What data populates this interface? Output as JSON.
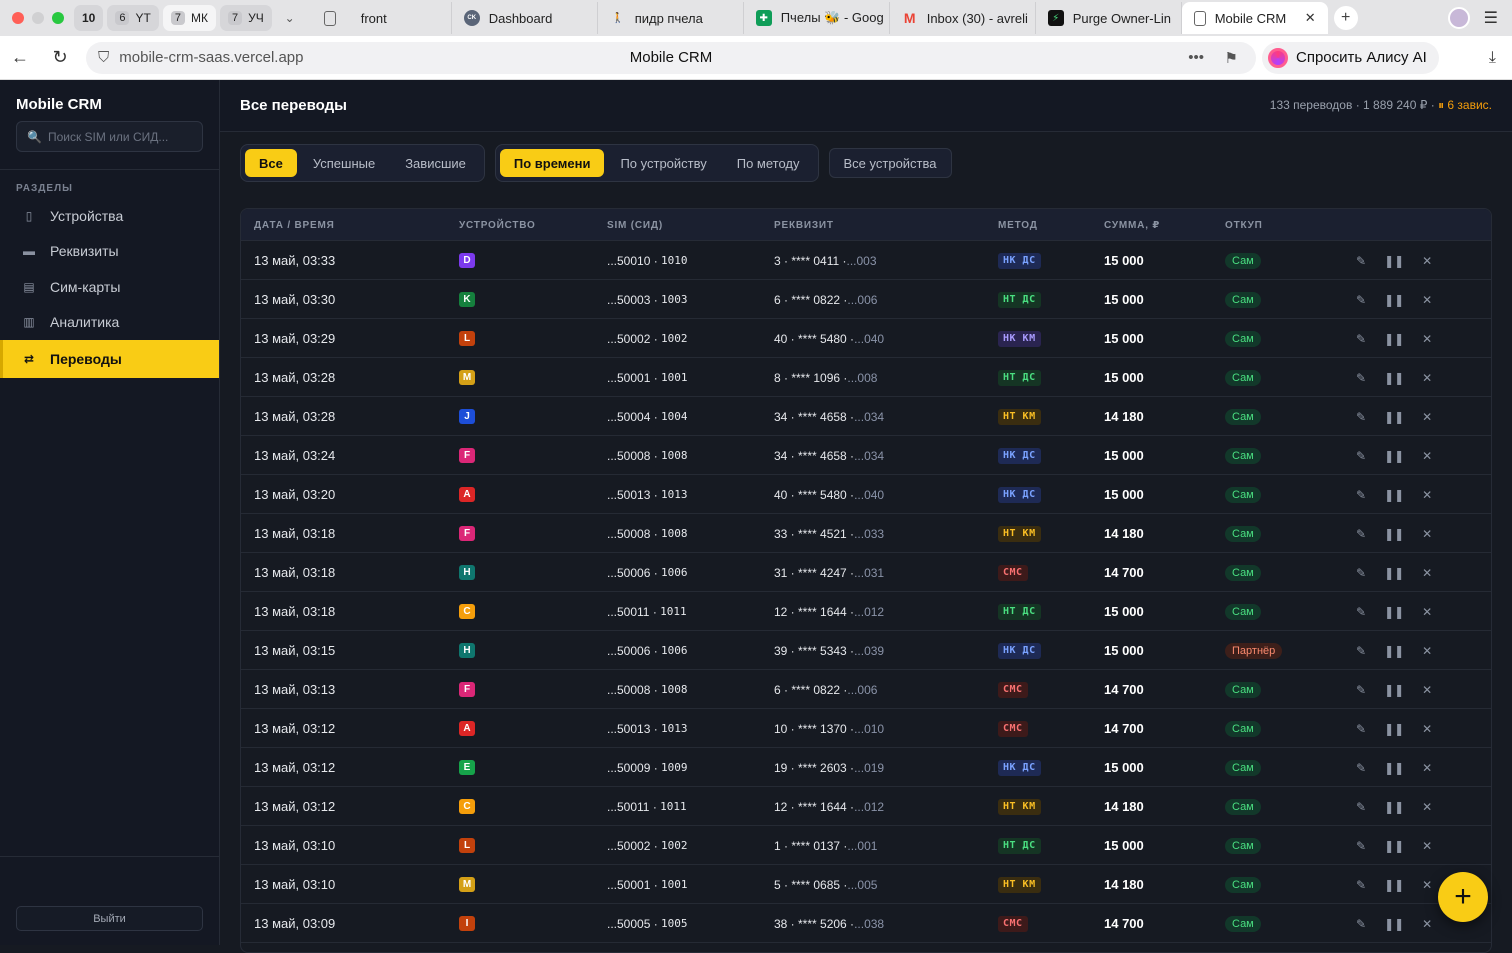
{
  "browser": {
    "pinned": [
      {
        "count": "10",
        "label": ""
      },
      {
        "count": "6",
        "label": "YT"
      },
      {
        "count": "7",
        "label": "МК"
      },
      {
        "count": "7",
        "label": "УЧ"
      }
    ],
    "tabs": [
      {
        "title": "front",
        "icon": "file-icon",
        "color": "#ffffff"
      },
      {
        "title": "Dashboard",
        "icon": "ck-icon",
        "color": "#5a6578"
      },
      {
        "title": "пидр пчела",
        "icon": "figure-icon",
        "color": "#ffffff"
      },
      {
        "title": "Пчелы 🐝 - Goog",
        "icon": "sheets-icon",
        "color": "#0f9d58"
      },
      {
        "title": "Inbox (30) - avreli",
        "icon": "gmail-icon",
        "color": "#ffffff"
      },
      {
        "title": "Purge Owner-Lin",
        "icon": "bolt-icon",
        "color": "#111111"
      },
      {
        "title": "Mobile CRM",
        "icon": "file-icon",
        "color": "#ffffff"
      }
    ],
    "url": "mobile-crm-saas.vercel.app",
    "page_title": "Mobile CRM",
    "alice": "Спросить Алису AI"
  },
  "sidebar": {
    "logo": "Mobile CRM",
    "search_placeholder": "Поиск SIM или СИД...",
    "section": "РАЗДЕЛЫ",
    "items": [
      {
        "label": "Устройства",
        "icon": "device-icon"
      },
      {
        "label": "Реквизиты",
        "icon": "card-icon"
      },
      {
        "label": "Сим-карты",
        "icon": "sim-icon"
      },
      {
        "label": "Аналитика",
        "icon": "chart-icon"
      },
      {
        "label": "Переводы",
        "icon": "transfer-icon"
      }
    ],
    "logout": "Выйти"
  },
  "header": {
    "title": "Все переводы",
    "stats": "133 переводов · 1 889 240 ₽ ·",
    "warn": "⏸ 6 завис."
  },
  "filters": {
    "status": [
      "Все",
      "Успешные",
      "Зависшие"
    ],
    "sort": [
      "По времени",
      "По устройству",
      "По методу"
    ],
    "devices": "Все устройства"
  },
  "table": {
    "columns": [
      "ДАТА / ВРЕМЯ",
      "УСТРОЙСТВО",
      "SIM (СИД)",
      "РЕКВИЗИТ",
      "МЕТОД",
      "СУММА, ₽",
      "ОТКУП"
    ],
    "rows": [
      {
        "date": "13 май, 03:33",
        "dev": "D",
        "dc": "#7c3aed",
        "sim": "...50010",
        "sid": "1010",
        "req": "3 · **** 0411 · ",
        "acc": "...003",
        "m": "НК ДС",
        "mt": "nk",
        "amt": "15 000",
        "buy": "Сам"
      },
      {
        "date": "13 май, 03:30",
        "dev": "K",
        "dc": "#15803d",
        "sim": "...50003",
        "sid": "1003",
        "req": "6 · **** 0822 · ",
        "acc": "...006",
        "m": "НТ ДС",
        "mt": "nt",
        "amt": "15 000",
        "buy": "Сам"
      },
      {
        "date": "13 май, 03:29",
        "dev": "L",
        "dc": "#c2410c",
        "sim": "...50002",
        "sid": "1002",
        "req": "40 · **** 5480 · ",
        "acc": "...040",
        "m": "НК КМ",
        "mt": "nkkm",
        "amt": "15 000",
        "buy": "Сам"
      },
      {
        "date": "13 май, 03:28",
        "dev": "M",
        "dc": "#d4a017",
        "sim": "...50001",
        "sid": "1001",
        "req": "8 · **** 1096 · ",
        "acc": "...008",
        "m": "НТ ДС",
        "mt": "nt",
        "amt": "15 000",
        "buy": "Сам"
      },
      {
        "date": "13 май, 03:28",
        "dev": "J",
        "dc": "#1d4ed8",
        "sim": "...50004",
        "sid": "1004",
        "req": "34 · **** 4658 · ",
        "acc": "...034",
        "m": "НТ КМ",
        "mt": "ntkm",
        "amt": "14 180",
        "buy": "Сам"
      },
      {
        "date": "13 май, 03:24",
        "dev": "F",
        "dc": "#db2777",
        "sim": "...50008",
        "sid": "1008",
        "req": "34 · **** 4658 · ",
        "acc": "...034",
        "m": "НК ДС",
        "mt": "nk",
        "amt": "15 000",
        "buy": "Сам"
      },
      {
        "date": "13 май, 03:20",
        "dev": "A",
        "dc": "#dc2626",
        "sim": "...50013",
        "sid": "1013",
        "req": "40 · **** 5480 · ",
        "acc": "...040",
        "m": "НК ДС",
        "mt": "nk",
        "amt": "15 000",
        "buy": "Сам"
      },
      {
        "date": "13 май, 03:18",
        "dev": "F",
        "dc": "#db2777",
        "sim": "...50008",
        "sid": "1008",
        "req": "33 · **** 4521 · ",
        "acc": "...033",
        "m": "НТ КМ",
        "mt": "ntkm",
        "amt": "14 180",
        "buy": "Сам"
      },
      {
        "date": "13 май, 03:18",
        "dev": "H",
        "dc": "#0f766e",
        "sim": "...50006",
        "sid": "1006",
        "req": "31 · **** 4247 · ",
        "acc": "...031",
        "m": "СМС",
        "mt": "sms",
        "amt": "14 700",
        "buy": "Сам"
      },
      {
        "date": "13 май, 03:18",
        "dev": "C",
        "dc": "#f59e0b",
        "sim": "...50011",
        "sid": "1011",
        "req": "12 · **** 1644 · ",
        "acc": "...012",
        "m": "НТ ДС",
        "mt": "nt",
        "amt": "15 000",
        "buy": "Сам"
      },
      {
        "date": "13 май, 03:15",
        "dev": "H",
        "dc": "#0f766e",
        "sim": "...50006",
        "sid": "1006",
        "req": "39 · **** 5343 · ",
        "acc": "...039",
        "m": "НК ДС",
        "mt": "nk",
        "amt": "15 000",
        "buy": "Партнёр"
      },
      {
        "date": "13 май, 03:13",
        "dev": "F",
        "dc": "#db2777",
        "sim": "...50008",
        "sid": "1008",
        "req": "6 · **** 0822 · ",
        "acc": "...006",
        "m": "СМС",
        "mt": "sms",
        "amt": "14 700",
        "buy": "Сам"
      },
      {
        "date": "13 май, 03:12",
        "dev": "A",
        "dc": "#dc2626",
        "sim": "...50013",
        "sid": "1013",
        "req": "10 · **** 1370 · ",
        "acc": "...010",
        "m": "СМС",
        "mt": "sms",
        "amt": "14 700",
        "buy": "Сам"
      },
      {
        "date": "13 май, 03:12",
        "dev": "E",
        "dc": "#16a34a",
        "sim": "...50009",
        "sid": "1009",
        "req": "19 · **** 2603 · ",
        "acc": "...019",
        "m": "НК ДС",
        "mt": "nk",
        "amt": "15 000",
        "buy": "Сам"
      },
      {
        "date": "13 май, 03:12",
        "dev": "C",
        "dc": "#f59e0b",
        "sim": "...50011",
        "sid": "1011",
        "req": "12 · **** 1644 · ",
        "acc": "...012",
        "m": "НТ КМ",
        "mt": "ntkm",
        "amt": "14 180",
        "buy": "Сам"
      },
      {
        "date": "13 май, 03:10",
        "dev": "L",
        "dc": "#c2410c",
        "sim": "...50002",
        "sid": "1002",
        "req": "1 · **** 0137 · ",
        "acc": "...001",
        "m": "НТ ДС",
        "mt": "nt",
        "amt": "15 000",
        "buy": "Сам"
      },
      {
        "date": "13 май, 03:10",
        "dev": "M",
        "dc": "#d4a017",
        "sim": "...50001",
        "sid": "1001",
        "req": "5 · **** 0685 · ",
        "acc": "...005",
        "m": "НТ КМ",
        "mt": "ntkm",
        "amt": "14 180",
        "buy": "Сам"
      },
      {
        "date": "13 май, 03:09",
        "dev": "I",
        "dc": "#c2410c",
        "sim": "...50005",
        "sid": "1005",
        "req": "38 · **** 5206 · ",
        "acc": "...038",
        "m": "СМС",
        "mt": "sms",
        "amt": "14 700",
        "buy": "Сам"
      }
    ]
  },
  "fab": "+"
}
